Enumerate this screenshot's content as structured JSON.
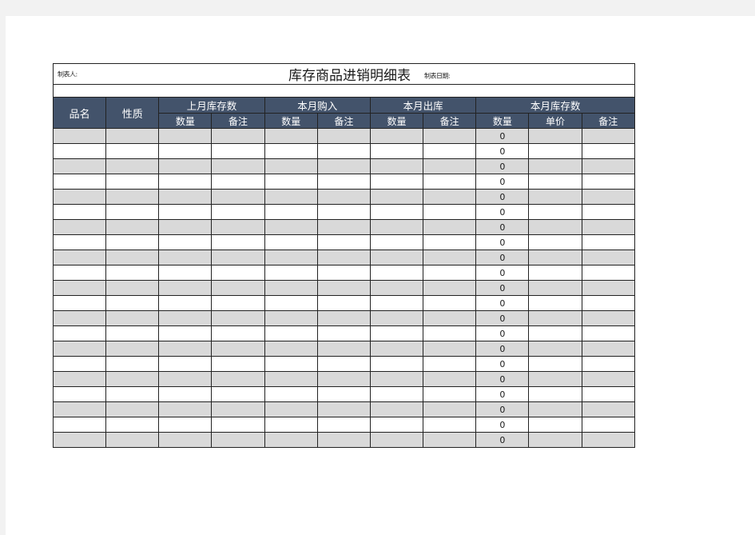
{
  "document": {
    "title": "库存商品进销明细表",
    "maker_label": "制表人:",
    "date_label": "制表日期:"
  },
  "table": {
    "group_headers": [
      {
        "label": "品名",
        "span": 1,
        "rowspan": 2,
        "name": "pinming"
      },
      {
        "label": "性质",
        "span": 1,
        "rowspan": 2,
        "name": "xingzhi"
      },
      {
        "label": "上月库存数",
        "span": 2,
        "rowspan": 1,
        "name": "last-month-stock"
      },
      {
        "label": "本月购入",
        "span": 2,
        "rowspan": 1,
        "name": "this-month-purchase"
      },
      {
        "label": "本月出库",
        "span": 2,
        "rowspan": 1,
        "name": "this-month-outbound"
      },
      {
        "label": "本月库存数",
        "span": 3,
        "rowspan": 1,
        "name": "this-month-stock"
      }
    ],
    "sub_headers": [
      {
        "label": "数量",
        "name": "last-stock-qty"
      },
      {
        "label": "备注",
        "name": "last-stock-remark"
      },
      {
        "label": "数量",
        "name": "purchase-qty"
      },
      {
        "label": "备注",
        "name": "purchase-remark"
      },
      {
        "label": "数量",
        "name": "outbound-qty"
      },
      {
        "label": "备注",
        "name": "outbound-remark"
      },
      {
        "label": "数量",
        "name": "stock-qty"
      },
      {
        "label": "单价",
        "name": "stock-unit-price"
      },
      {
        "label": "备注",
        "name": "stock-remark"
      }
    ],
    "computed_column_index": 8,
    "rows": [
      {
        "pinming": "",
        "xingzhi": "",
        "last_qty": "",
        "last_remark": "",
        "buy_qty": "",
        "buy_remark": "",
        "out_qty": "",
        "out_remark": "",
        "stock_qty": "0",
        "unit_price": "",
        "stock_remark": ""
      },
      {
        "pinming": "",
        "xingzhi": "",
        "last_qty": "",
        "last_remark": "",
        "buy_qty": "",
        "buy_remark": "",
        "out_qty": "",
        "out_remark": "",
        "stock_qty": "0",
        "unit_price": "",
        "stock_remark": ""
      },
      {
        "pinming": "",
        "xingzhi": "",
        "last_qty": "",
        "last_remark": "",
        "buy_qty": "",
        "buy_remark": "",
        "out_qty": "",
        "out_remark": "",
        "stock_qty": "0",
        "unit_price": "",
        "stock_remark": ""
      },
      {
        "pinming": "",
        "xingzhi": "",
        "last_qty": "",
        "last_remark": "",
        "buy_qty": "",
        "buy_remark": "",
        "out_qty": "",
        "out_remark": "",
        "stock_qty": "0",
        "unit_price": "",
        "stock_remark": ""
      },
      {
        "pinming": "",
        "xingzhi": "",
        "last_qty": "",
        "last_remark": "",
        "buy_qty": "",
        "buy_remark": "",
        "out_qty": "",
        "out_remark": "",
        "stock_qty": "0",
        "unit_price": "",
        "stock_remark": ""
      },
      {
        "pinming": "",
        "xingzhi": "",
        "last_qty": "",
        "last_remark": "",
        "buy_qty": "",
        "buy_remark": "",
        "out_qty": "",
        "out_remark": "",
        "stock_qty": "0",
        "unit_price": "",
        "stock_remark": ""
      },
      {
        "pinming": "",
        "xingzhi": "",
        "last_qty": "",
        "last_remark": "",
        "buy_qty": "",
        "buy_remark": "",
        "out_qty": "",
        "out_remark": "",
        "stock_qty": "0",
        "unit_price": "",
        "stock_remark": ""
      },
      {
        "pinming": "",
        "xingzhi": "",
        "last_qty": "",
        "last_remark": "",
        "buy_qty": "",
        "buy_remark": "",
        "out_qty": "",
        "out_remark": "",
        "stock_qty": "0",
        "unit_price": "",
        "stock_remark": ""
      },
      {
        "pinming": "",
        "xingzhi": "",
        "last_qty": "",
        "last_remark": "",
        "buy_qty": "",
        "buy_remark": "",
        "out_qty": "",
        "out_remark": "",
        "stock_qty": "0",
        "unit_price": "",
        "stock_remark": ""
      },
      {
        "pinming": "",
        "xingzhi": "",
        "last_qty": "",
        "last_remark": "",
        "buy_qty": "",
        "buy_remark": "",
        "out_qty": "",
        "out_remark": "",
        "stock_qty": "0",
        "unit_price": "",
        "stock_remark": ""
      },
      {
        "pinming": "",
        "xingzhi": "",
        "last_qty": "",
        "last_remark": "",
        "buy_qty": "",
        "buy_remark": "",
        "out_qty": "",
        "out_remark": "",
        "stock_qty": "0",
        "unit_price": "",
        "stock_remark": ""
      },
      {
        "pinming": "",
        "xingzhi": "",
        "last_qty": "",
        "last_remark": "",
        "buy_qty": "",
        "buy_remark": "",
        "out_qty": "",
        "out_remark": "",
        "stock_qty": "0",
        "unit_price": "",
        "stock_remark": ""
      },
      {
        "pinming": "",
        "xingzhi": "",
        "last_qty": "",
        "last_remark": "",
        "buy_qty": "",
        "buy_remark": "",
        "out_qty": "",
        "out_remark": "",
        "stock_qty": "0",
        "unit_price": "",
        "stock_remark": ""
      },
      {
        "pinming": "",
        "xingzhi": "",
        "last_qty": "",
        "last_remark": "",
        "buy_qty": "",
        "buy_remark": "",
        "out_qty": "",
        "out_remark": "",
        "stock_qty": "0",
        "unit_price": "",
        "stock_remark": ""
      },
      {
        "pinming": "",
        "xingzhi": "",
        "last_qty": "",
        "last_remark": "",
        "buy_qty": "",
        "buy_remark": "",
        "out_qty": "",
        "out_remark": "",
        "stock_qty": "0",
        "unit_price": "",
        "stock_remark": ""
      },
      {
        "pinming": "",
        "xingzhi": "",
        "last_qty": "",
        "last_remark": "",
        "buy_qty": "",
        "buy_remark": "",
        "out_qty": "",
        "out_remark": "",
        "stock_qty": "0",
        "unit_price": "",
        "stock_remark": ""
      },
      {
        "pinming": "",
        "xingzhi": "",
        "last_qty": "",
        "last_remark": "",
        "buy_qty": "",
        "buy_remark": "",
        "out_qty": "",
        "out_remark": "",
        "stock_qty": "0",
        "unit_price": "",
        "stock_remark": ""
      },
      {
        "pinming": "",
        "xingzhi": "",
        "last_qty": "",
        "last_remark": "",
        "buy_qty": "",
        "buy_remark": "",
        "out_qty": "",
        "out_remark": "",
        "stock_qty": "0",
        "unit_price": "",
        "stock_remark": ""
      },
      {
        "pinming": "",
        "xingzhi": "",
        "last_qty": "",
        "last_remark": "",
        "buy_qty": "",
        "buy_remark": "",
        "out_qty": "",
        "out_remark": "",
        "stock_qty": "0",
        "unit_price": "",
        "stock_remark": ""
      },
      {
        "pinming": "",
        "xingzhi": "",
        "last_qty": "",
        "last_remark": "",
        "buy_qty": "",
        "buy_remark": "",
        "out_qty": "",
        "out_remark": "",
        "stock_qty": "0",
        "unit_price": "",
        "stock_remark": ""
      },
      {
        "pinming": "",
        "xingzhi": "",
        "last_qty": "",
        "last_remark": "",
        "buy_qty": "",
        "buy_remark": "",
        "out_qty": "",
        "out_remark": "",
        "stock_qty": "0",
        "unit_price": "",
        "stock_remark": ""
      }
    ]
  },
  "colors": {
    "header_bg": "#43536b",
    "header_text": "#ffffff",
    "row_alt_bg": "#d9d9d9",
    "row_bg": "#ffffff",
    "grid_line": "#222222",
    "page_bg": "#ffffff",
    "canvas_bg": "#f2f2f2"
  }
}
